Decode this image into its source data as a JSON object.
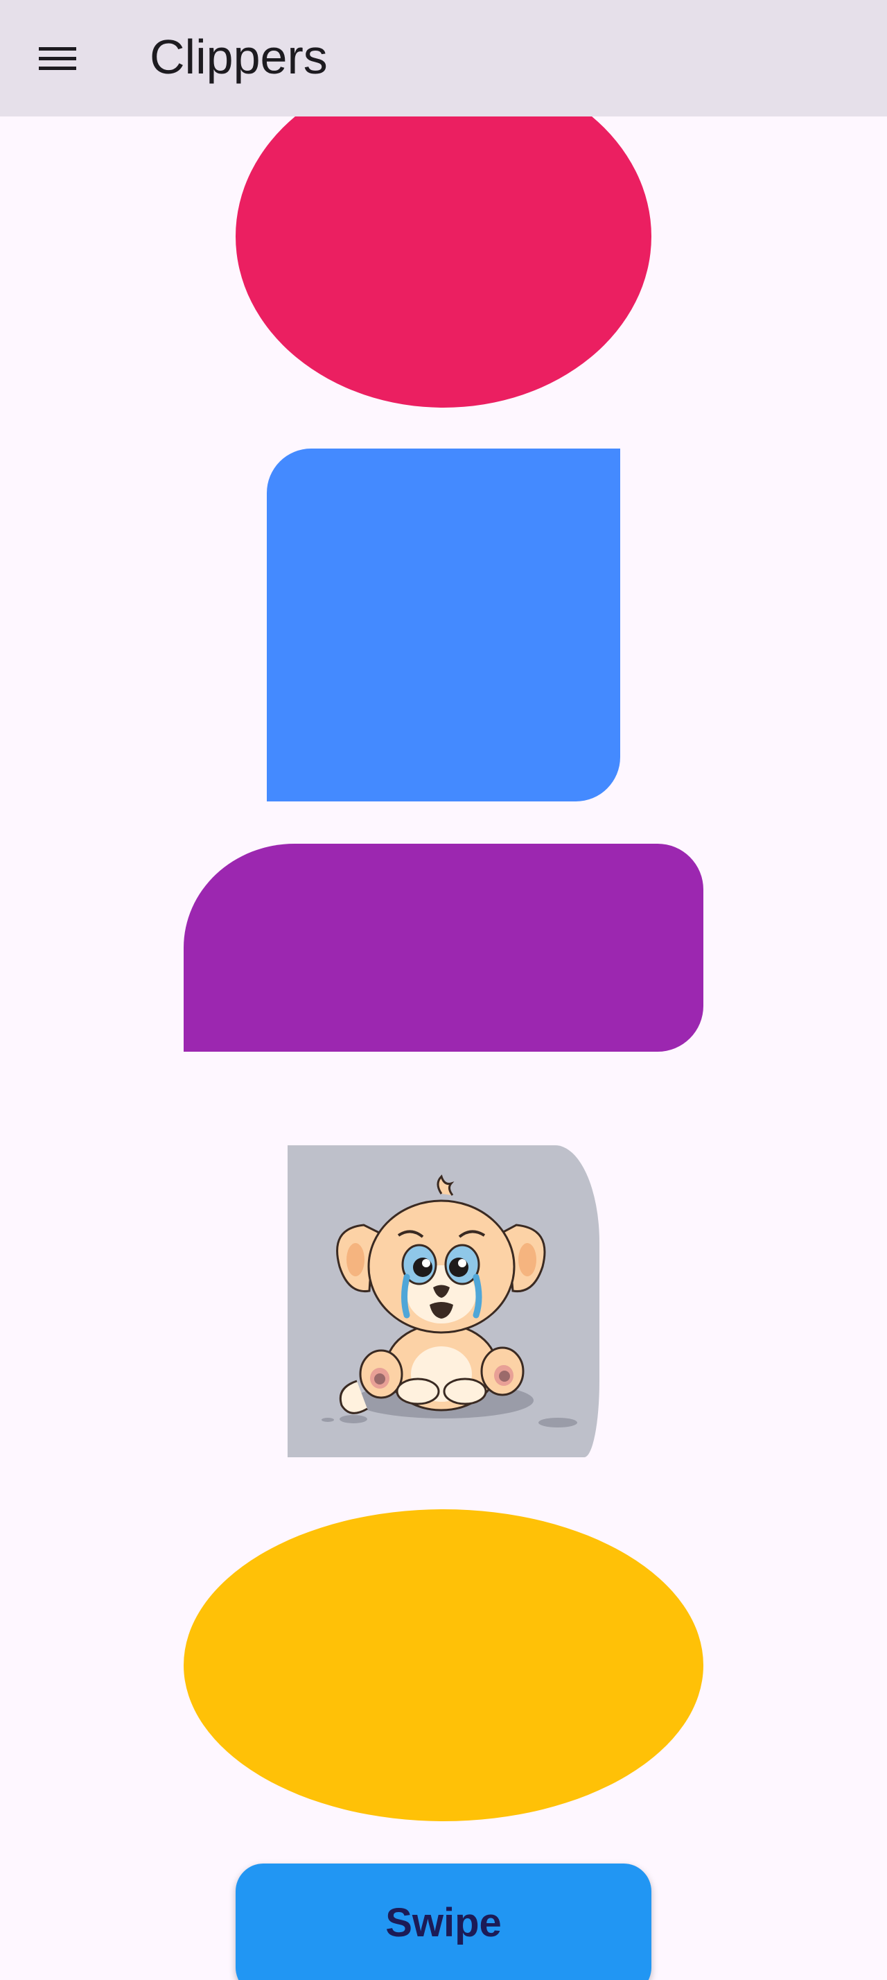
{
  "app_bar": {
    "title": "Clippers",
    "menu_icon": "hamburger-menu-icon"
  },
  "shapes": [
    {
      "name": "red-oval",
      "color": "#EB1F61",
      "shape": "oval"
    },
    {
      "name": "blue-box",
      "color": "#448AFF",
      "shape": "rounded-corner-box"
    },
    {
      "name": "purple-box",
      "color": "#9C27B0",
      "shape": "rounded-corner-box"
    },
    {
      "name": "puppy-card",
      "image": "crying-puppy-illustration",
      "background": "#BEC0CA"
    },
    {
      "name": "yellow-oval",
      "color": "#FFC107",
      "shape": "oval"
    }
  ],
  "swipe_button": {
    "label": "Swipe",
    "color": "#2196F3"
  },
  "colors": {
    "background": "#FEF7FF",
    "app_bar": "#E6E0EA"
  }
}
